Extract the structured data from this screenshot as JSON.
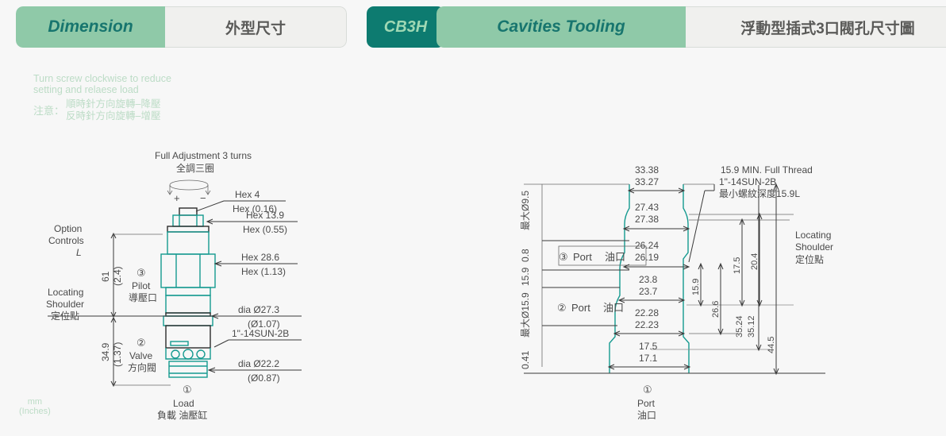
{
  "header": {
    "tabs": [
      {
        "en": "Dimension",
        "zh": "外型尺寸"
      },
      {
        "en": "Cavities Tooling",
        "zh": "浮動型插式3口閥孔尺寸圖"
      }
    ],
    "code": "CB3H"
  },
  "note": {
    "en_line1": "Turn screw clockwise to reduce",
    "en_line2": "setting and relaese load",
    "zh_label": "注意：",
    "zh_line1": "順時針方向旋轉–降壓",
    "zh_line2": "反時針方向旋轉–增壓"
  },
  "units": {
    "mm": "mm",
    "inches": "(Inches)"
  },
  "left_drawing": {
    "title_en": "Full Adjustment 3 turns",
    "title_zh": "全調三圈",
    "plus": "+",
    "minus": "−",
    "option_controls_line1": "Option",
    "option_controls_line2": "Controls",
    "option_controls_line3": "L",
    "locating_en1": "Locating",
    "locating_en2": "Shoulder",
    "locating_zh": "定位點",
    "dim_upper_mm": "61",
    "dim_upper_in": "(2.4)",
    "dim_lower_mm": "34.9",
    "dim_lower_in": "(1.37)",
    "callouts": [
      {
        "mm": "Hex 4",
        "in": "Hex (0.16)"
      },
      {
        "mm": "Hex 13.9",
        "in": "Hex (0.55)"
      },
      {
        "mm": "Hex 28.6",
        "in": "Hex (1.13)"
      },
      {
        "mm": "dia  Ø27.3",
        "in": "(Ø1.07)"
      },
      {
        "mm": "1\"-14SUN-2B",
        "in": ""
      },
      {
        "mm": "dia  Ø22.2",
        "in": "(Ø0.87)"
      }
    ],
    "ports": [
      {
        "num": "③",
        "en": "Pilot",
        "zh": "導壓口"
      },
      {
        "num": "②",
        "en": "Valve",
        "zh": "方向閥"
      },
      {
        "num": "①",
        "en": "Load",
        "zh": "負載 油壓缸"
      }
    ]
  },
  "right_drawing": {
    "thread_note_line1": "15.9 MIN. Full Thread",
    "thread_note_line2": "1\"-14SUN-2B",
    "thread_note_line3": "最小螺紋深度15.9L",
    "locating_en1": "Locating",
    "locating_en2": "Shoulder",
    "locating_zh": "定位點",
    "diameters": [
      {
        "max": "33.38",
        "min": "33.27"
      },
      {
        "max": "27.43",
        "min": "27.38"
      },
      {
        "max": "26.24",
        "min": "26.19"
      },
      {
        "max": "23.8",
        "min": "23.7"
      },
      {
        "max": "22.28",
        "min": "22.23"
      },
      {
        "max": "17.5",
        "min": "17.1"
      }
    ],
    "left_labels": {
      "max_d95": "最大Ø9.5",
      "d_15_9": "15.9",
      "d_0_8": "0.8",
      "max_d159": "最大Ø15.9",
      "d_0_41": "0.41"
    },
    "depths": {
      "d_15_9": "15.9",
      "d_17_5": "17.5",
      "d_20_4": "20.4",
      "d_26_6": "26.6",
      "d_35_24": "35.24",
      "d_35_12": "35.12",
      "d_44_5": "44.5"
    },
    "port": {
      "num": "①",
      "en": "Port",
      "zh": "油口"
    },
    "ports_side": [
      {
        "num": "③",
        "en": "Port",
        "zh": "油口"
      },
      {
        "num": "②",
        "en": "Port",
        "zh": "油口"
      }
    ]
  },
  "colors": {
    "tab_green": "#8fc9a8",
    "tab_teal": "#0d7b70",
    "text_teal": "#17756e",
    "part_teal": "#159a90",
    "note_green": "#bcdcc6"
  }
}
